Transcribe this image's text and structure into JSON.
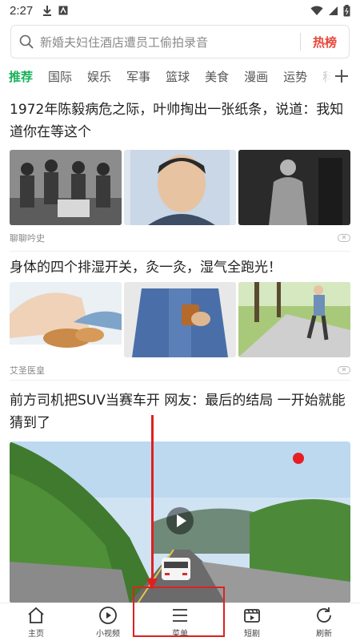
{
  "status_bar": {
    "time": "2:27"
  },
  "search": {
    "placeholder": "新婚夫妇住酒店遭员工偷拍录音",
    "hot_label": "热榜"
  },
  "tabs": [
    {
      "label": "推荐",
      "active": true
    },
    {
      "label": "国际"
    },
    {
      "label": "娱乐"
    },
    {
      "label": "军事"
    },
    {
      "label": "篮球"
    },
    {
      "label": "美食"
    },
    {
      "label": "漫画"
    },
    {
      "label": "运势"
    },
    {
      "label": "科"
    }
  ],
  "articles": [
    {
      "title": "1972年陈毅病危之际，叶帅掏出一张纸条，说道：我知道你在等这个",
      "source": "聊聊吟史"
    },
    {
      "title": "身体的四个排湿开关，灸一灸，湿气全跑光！",
      "source": "艾圣医皇"
    },
    {
      "title": "前方司机把SUV当赛车开 网友：最后的结局 一开始就能猜到了"
    }
  ],
  "bottom_nav": [
    {
      "label": "主页",
      "icon": "home-icon"
    },
    {
      "label": "小视频",
      "icon": "play-circle-icon"
    },
    {
      "label": "菜单",
      "icon": "menu-icon"
    },
    {
      "label": "短剧",
      "icon": "film-icon"
    },
    {
      "label": "刷新",
      "icon": "refresh-icon"
    }
  ],
  "colors": {
    "accent": "#18b35a",
    "hot": "#e8483c",
    "annotation": "#e02020"
  }
}
